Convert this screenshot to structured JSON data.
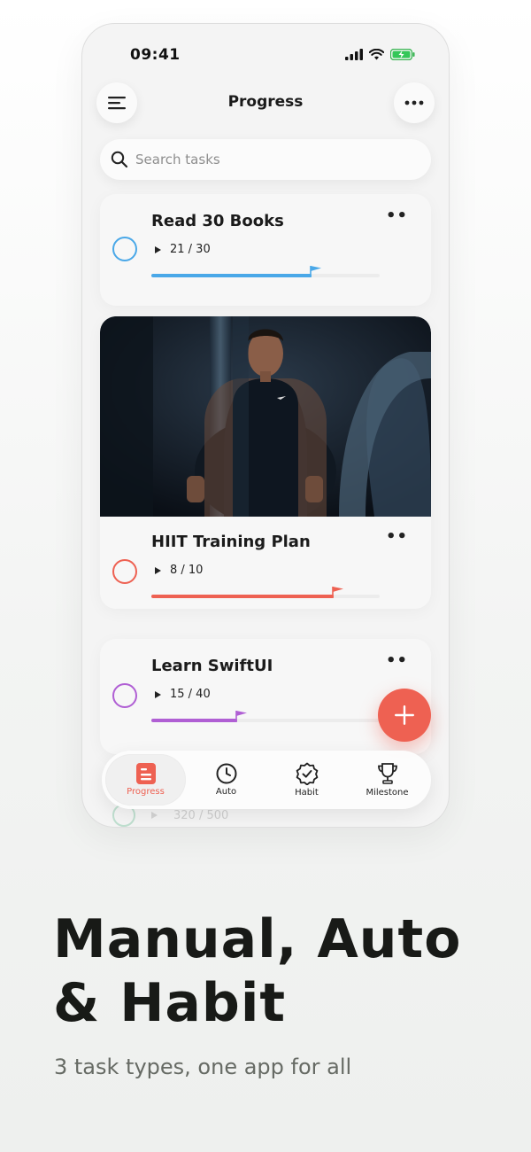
{
  "status": {
    "time": "09:41"
  },
  "header": {
    "title": "Progress"
  },
  "search": {
    "placeholder": "Search tasks"
  },
  "tasks": [
    {
      "title": "Read 30 Books",
      "count": "21 / 30",
      "progress": 0.7,
      "color": "#4aa8e8"
    },
    {
      "title": "HIIT Training Plan",
      "count": "8 / 10",
      "progress": 0.8,
      "color": "#ee6152"
    },
    {
      "title": "Learn SwiftUI",
      "count": "15 / 40",
      "progress": 0.375,
      "color": "#b05fd4"
    }
  ],
  "ghost_task": {
    "count": "320 / 500"
  },
  "tabs": [
    {
      "label": "Progress",
      "icon": "progress-icon",
      "active": true
    },
    {
      "label": "Auto",
      "icon": "clock-icon",
      "active": false
    },
    {
      "label": "Habit",
      "icon": "badge-check-icon",
      "active": false
    },
    {
      "label": "Milestone",
      "icon": "trophy-icon",
      "active": false
    }
  ],
  "promo": {
    "headline_line1": "Manual, Auto",
    "headline_line2": "& Habit",
    "subline": "3 task types, one app for all"
  },
  "colors": {
    "accent": "#ee6152",
    "blue": "#4aa8e8",
    "purple": "#b05fd4"
  }
}
